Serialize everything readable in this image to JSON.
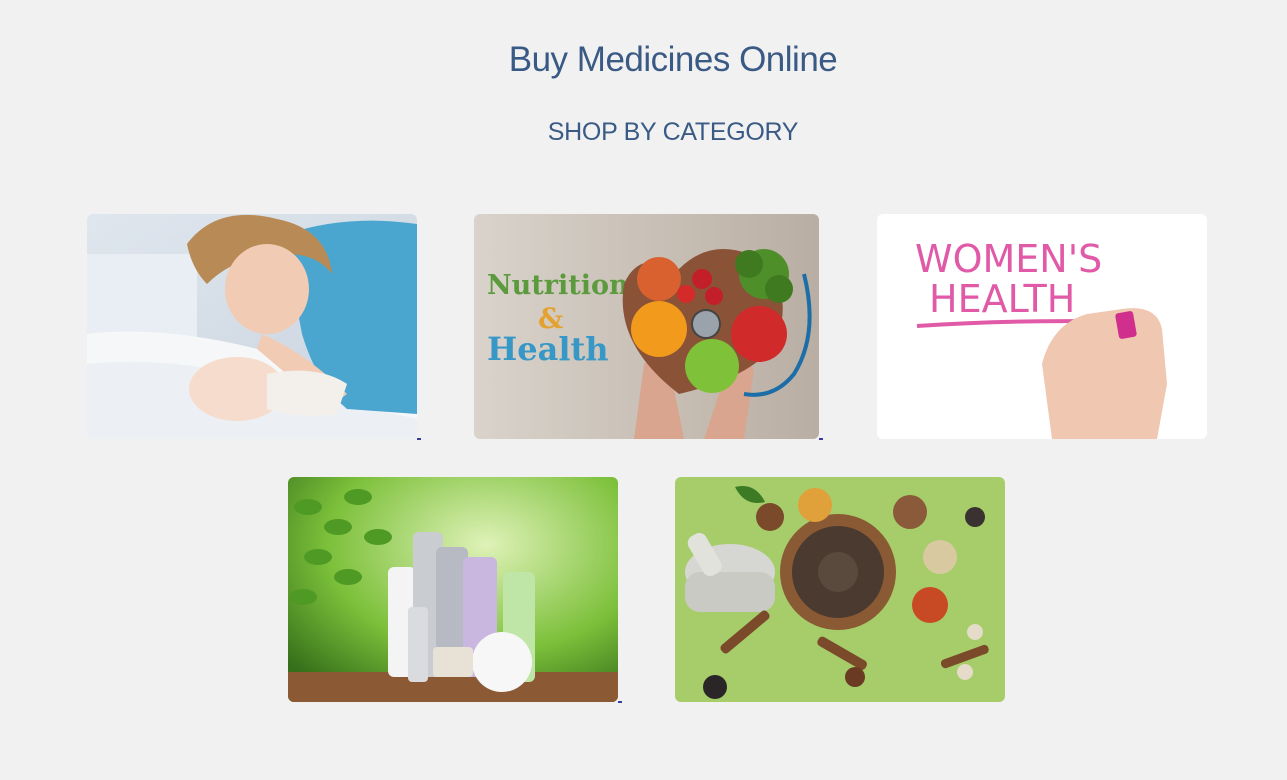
{
  "page": {
    "title": "Buy Medicines Online",
    "subtitle": "SHOP BY CATEGORY"
  },
  "categories": {
    "nutrition": {
      "line1": "Nutrition",
      "line2": "&",
      "line3": "Health"
    },
    "womens": {
      "line1": "WOMEN'S",
      "line2": "HEALTH"
    }
  },
  "colors": {
    "heading": "#3a5a86",
    "background": "#f2f1f1"
  }
}
